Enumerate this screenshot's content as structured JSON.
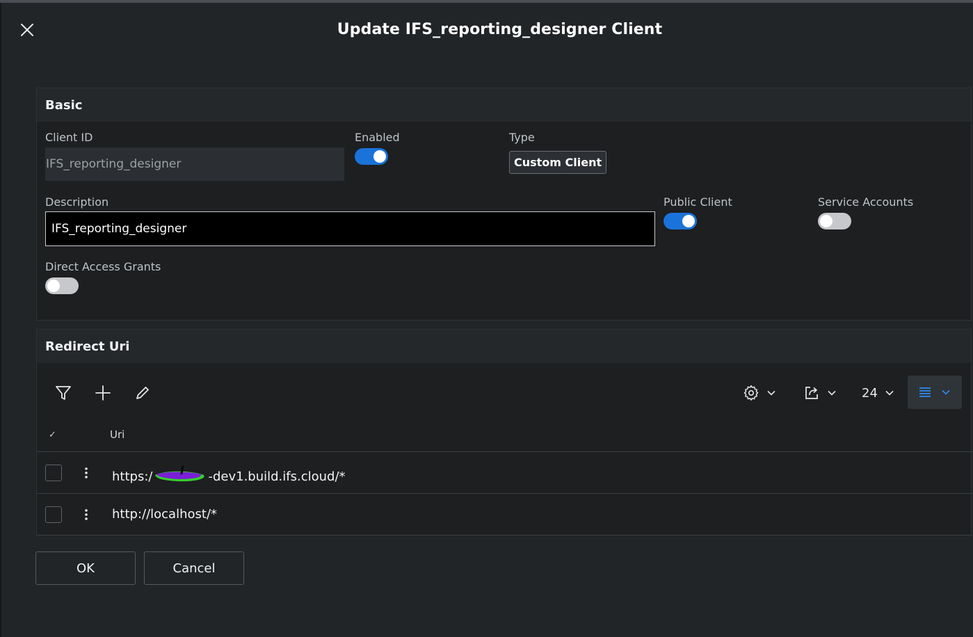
{
  "dialog": {
    "title": "Update IFS_reporting_designer Client",
    "close_icon": "close-icon"
  },
  "basic": {
    "header": "Basic",
    "client_id_label": "Client ID",
    "client_id_value": "IFS_reporting_designer",
    "enabled_label": "Enabled",
    "enabled": true,
    "type_label": "Type",
    "type_value": "Custom Client",
    "description_label": "Description",
    "description_value": "IFS_reporting_designer",
    "public_client_label": "Public Client",
    "public_client": true,
    "service_accounts_label": "Service Accounts",
    "service_accounts": false,
    "direct_access_grants_label": "Direct Access Grants",
    "direct_access_grants": false
  },
  "redirect": {
    "header": "Redirect Uri",
    "toolbar": {
      "filter_icon": "filter-icon",
      "add_icon": "plus-icon",
      "edit_icon": "pencil-icon",
      "settings_icon": "gear-icon",
      "export_icon": "export-icon",
      "page_size": "24",
      "view_icon": "list-view-icon"
    },
    "columns": {
      "select_mark": "✓",
      "uri": "Uri"
    },
    "rows": [
      {
        "uri_prefix": "https:/",
        "uri_suffix": "-dev1.build.ifs.cloud/*"
      },
      {
        "uri": "http://localhost/*"
      }
    ]
  },
  "footer": {
    "ok_label": "OK",
    "cancel_label": "Cancel"
  },
  "colors": {
    "accent": "#1a73d9",
    "background": "#222528",
    "panel": "#1d1f21",
    "redaction_purple": "#7a1fd6",
    "redaction_green": "#36d12a"
  }
}
